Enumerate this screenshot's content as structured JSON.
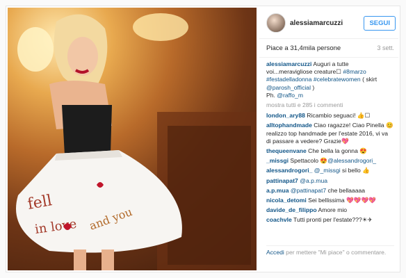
{
  "post": {
    "username": "alessiamarcuzzi",
    "follow_label": "SEGUI",
    "likes": "Piace a 31,4mila persone",
    "date": "3 sett.",
    "caption_user": "alessiamarcuzzi",
    "caption_text_1": " Auguri a tutte voi...meravigliose creature☐ ",
    "caption_tag_1": "#8marzo",
    "caption_tag_2": "#festadelladonna",
    "caption_tag_3": "#celebratewomen",
    "caption_text_2": " ( skirt ",
    "caption_mention_1": "@parosh_official",
    "caption_text_3": " )",
    "caption_text_4": "Ph. ",
    "caption_mention_2": "@raffo_m",
    "show_all": "mostra tutti e 285 i commenti"
  },
  "comments": [
    {
      "user": "london_ary88",
      "pre": " Ricambio seguaci! 👍☐",
      "mention": "",
      "post": ""
    },
    {
      "user": "alltophandmade",
      "pre": " Ciao ragazze! Ciao Pinella 😊 realizzo top handmade per l'estate 2016, vi va di passare a vedere? Grazie💖",
      "mention": "",
      "post": ""
    },
    {
      "user": "thequeenvane",
      "pre": " Che bella la gonna 😍",
      "mention": "",
      "post": ""
    },
    {
      "user": "_missgi",
      "pre": " Spettacolo 😍",
      "mention": "@alessandrogori_",
      "post": ""
    },
    {
      "user": "alessandrogori_",
      "pre": " ",
      "mention": "@_missgi",
      "post": " si bello 👍"
    },
    {
      "user": "pattinapat7",
      "pre": " ",
      "mention": "@a.p.mua",
      "post": ""
    },
    {
      "user": "a.p.mua",
      "pre": " ",
      "mention": "@pattinapat7",
      "post": " che bellaaaaa"
    },
    {
      "user": "nicola_detomi",
      "pre": " Sei bellissima 💖💖💖💖",
      "mention": "",
      "post": ""
    },
    {
      "user": "davide_de_filippo",
      "pre": " Amore mio",
      "mention": "",
      "post": ""
    },
    {
      "user": "coachvle",
      "pre": " Tutti pronti per l'estate???☀✈",
      "mention": "",
      "post": ""
    }
  ],
  "footer": {
    "login_link": "Accedi",
    "rest": " per mettere \"Mi piace\" o commentare."
  },
  "colors": {
    "link": "#125688",
    "follow": "#3897f0"
  },
  "photo": {
    "skirt_text_1": "fell",
    "skirt_text_2": "in love",
    "skirt_text_3": "and you"
  }
}
